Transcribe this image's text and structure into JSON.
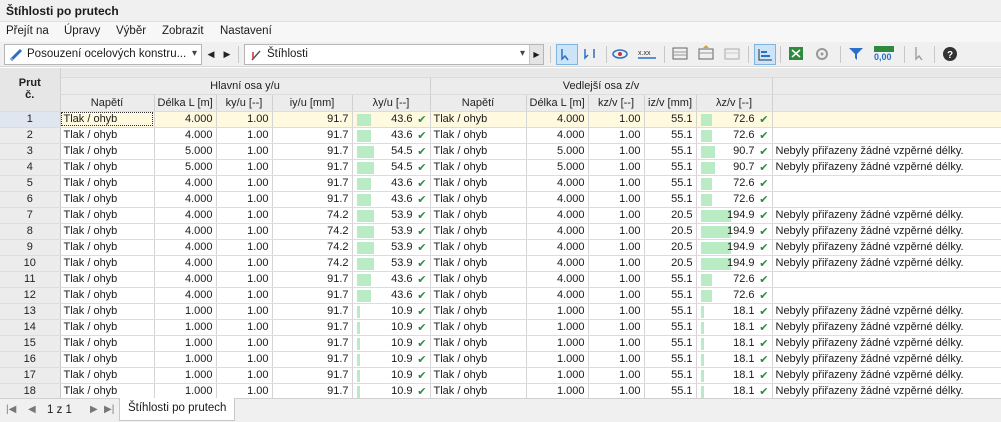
{
  "window": {
    "title": "Štíhlosti po prutech"
  },
  "menu": [
    "Přejít na",
    "Úpravy",
    "Výběr",
    "Zobrazit",
    "Nastavení"
  ],
  "toolbar": {
    "combo1": "Posouzení ocelových konstru...",
    "combo2": "Štíhlosti",
    "zoom_value": "0,00"
  },
  "table": {
    "headers": {
      "prut": "Prut",
      "prut_sub": "č.",
      "group_y": "Hlavní osa y/u",
      "group_z": "Vedlejší osa z/v",
      "napeti": "Napětí",
      "delka": "Délka L [m]",
      "k_y": "ky/u [--]",
      "i_y": "iy/u [mm]",
      "lambda_y": "λy/u [--]",
      "napeti_z": "Napětí",
      "delka_z": "Délka L [m]",
      "k_z": "kz/v [--]",
      "i_z": "iz/v [mm]",
      "lambda_z": "λz/v [--]"
    },
    "lambda_max": 194.9,
    "rows": [
      {
        "n": "1",
        "s": "Tlak / ohyb",
        "L": "4.000",
        "k": "1.00",
        "i": "91.7",
        "lam": "43.6",
        "sz": "Tlak / ohyb",
        "Lz": "4.000",
        "kz": "1.00",
        "iz": "55.1",
        "lamz": "72.6",
        "note": ""
      },
      {
        "n": "2",
        "s": "Tlak / ohyb",
        "L": "4.000",
        "k": "1.00",
        "i": "91.7",
        "lam": "43.6",
        "sz": "Tlak / ohyb",
        "Lz": "4.000",
        "kz": "1.00",
        "iz": "55.1",
        "lamz": "72.6",
        "note": ""
      },
      {
        "n": "3",
        "s": "Tlak / ohyb",
        "L": "5.000",
        "k": "1.00",
        "i": "91.7",
        "lam": "54.5",
        "sz": "Tlak / ohyb",
        "Lz": "5.000",
        "kz": "1.00",
        "iz": "55.1",
        "lamz": "90.7",
        "note": "Nebyly přiřazeny žádné vzpěrné délky."
      },
      {
        "n": "4",
        "s": "Tlak / ohyb",
        "L": "5.000",
        "k": "1.00",
        "i": "91.7",
        "lam": "54.5",
        "sz": "Tlak / ohyb",
        "Lz": "5.000",
        "kz": "1.00",
        "iz": "55.1",
        "lamz": "90.7",
        "note": "Nebyly přiřazeny žádné vzpěrné délky."
      },
      {
        "n": "5",
        "s": "Tlak / ohyb",
        "L": "4.000",
        "k": "1.00",
        "i": "91.7",
        "lam": "43.6",
        "sz": "Tlak / ohyb",
        "Lz": "4.000",
        "kz": "1.00",
        "iz": "55.1",
        "lamz": "72.6",
        "note": ""
      },
      {
        "n": "6",
        "s": "Tlak / ohyb",
        "L": "4.000",
        "k": "1.00",
        "i": "91.7",
        "lam": "43.6",
        "sz": "Tlak / ohyb",
        "Lz": "4.000",
        "kz": "1.00",
        "iz": "55.1",
        "lamz": "72.6",
        "note": ""
      },
      {
        "n": "7",
        "s": "Tlak / ohyb",
        "L": "4.000",
        "k": "1.00",
        "i": "74.2",
        "lam": "53.9",
        "sz": "Tlak / ohyb",
        "Lz": "4.000",
        "kz": "1.00",
        "iz": "20.5",
        "lamz": "194.9",
        "note": "Nebyly přiřazeny žádné vzpěrné délky."
      },
      {
        "n": "8",
        "s": "Tlak / ohyb",
        "L": "4.000",
        "k": "1.00",
        "i": "74.2",
        "lam": "53.9",
        "sz": "Tlak / ohyb",
        "Lz": "4.000",
        "kz": "1.00",
        "iz": "20.5",
        "lamz": "194.9",
        "note": "Nebyly přiřazeny žádné vzpěrné délky."
      },
      {
        "n": "9",
        "s": "Tlak / ohyb",
        "L": "4.000",
        "k": "1.00",
        "i": "74.2",
        "lam": "53.9",
        "sz": "Tlak / ohyb",
        "Lz": "4.000",
        "kz": "1.00",
        "iz": "20.5",
        "lamz": "194.9",
        "note": "Nebyly přiřazeny žádné vzpěrné délky."
      },
      {
        "n": "10",
        "s": "Tlak / ohyb",
        "L": "4.000",
        "k": "1.00",
        "i": "74.2",
        "lam": "53.9",
        "sz": "Tlak / ohyb",
        "Lz": "4.000",
        "kz": "1.00",
        "iz": "20.5",
        "lamz": "194.9",
        "note": "Nebyly přiřazeny žádné vzpěrné délky."
      },
      {
        "n": "11",
        "s": "Tlak / ohyb",
        "L": "4.000",
        "k": "1.00",
        "i": "91.7",
        "lam": "43.6",
        "sz": "Tlak / ohyb",
        "Lz": "4.000",
        "kz": "1.00",
        "iz": "55.1",
        "lamz": "72.6",
        "note": ""
      },
      {
        "n": "12",
        "s": "Tlak / ohyb",
        "L": "4.000",
        "k": "1.00",
        "i": "91.7",
        "lam": "43.6",
        "sz": "Tlak / ohyb",
        "Lz": "4.000",
        "kz": "1.00",
        "iz": "55.1",
        "lamz": "72.6",
        "note": ""
      },
      {
        "n": "13",
        "s": "Tlak / ohyb",
        "L": "1.000",
        "k": "1.00",
        "i": "91.7",
        "lam": "10.9",
        "sz": "Tlak / ohyb",
        "Lz": "1.000",
        "kz": "1.00",
        "iz": "55.1",
        "lamz": "18.1",
        "note": "Nebyly přiřazeny žádné vzpěrné délky."
      },
      {
        "n": "14",
        "s": "Tlak / ohyb",
        "L": "1.000",
        "k": "1.00",
        "i": "91.7",
        "lam": "10.9",
        "sz": "Tlak / ohyb",
        "Lz": "1.000",
        "kz": "1.00",
        "iz": "55.1",
        "lamz": "18.1",
        "note": "Nebyly přiřazeny žádné vzpěrné délky."
      },
      {
        "n": "15",
        "s": "Tlak / ohyb",
        "L": "1.000",
        "k": "1.00",
        "i": "91.7",
        "lam": "10.9",
        "sz": "Tlak / ohyb",
        "Lz": "1.000",
        "kz": "1.00",
        "iz": "55.1",
        "lamz": "18.1",
        "note": "Nebyly přiřazeny žádné vzpěrné délky."
      },
      {
        "n": "16",
        "s": "Tlak / ohyb",
        "L": "1.000",
        "k": "1.00",
        "i": "91.7",
        "lam": "10.9",
        "sz": "Tlak / ohyb",
        "Lz": "1.000",
        "kz": "1.00",
        "iz": "55.1",
        "lamz": "18.1",
        "note": "Nebyly přiřazeny žádné vzpěrné délky."
      },
      {
        "n": "17",
        "s": "Tlak / ohyb",
        "L": "1.000",
        "k": "1.00",
        "i": "91.7",
        "lam": "10.9",
        "sz": "Tlak / ohyb",
        "Lz": "1.000",
        "kz": "1.00",
        "iz": "55.1",
        "lamz": "18.1",
        "note": "Nebyly přiřazeny žádné vzpěrné délky."
      },
      {
        "n": "18",
        "s": "Tlak / ohyb",
        "L": "1.000",
        "k": "1.00",
        "i": "91.7",
        "lam": "10.9",
        "sz": "Tlak / ohyb",
        "Lz": "1.000",
        "kz": "1.00",
        "iz": "55.1",
        "lamz": "18.1",
        "note": "Nebyly přiřazeny žádné vzpěrné délky."
      }
    ]
  },
  "status": {
    "page": "1 z 1",
    "sheet_tab": "Štíhlosti po prutech"
  },
  "colors": {
    "bar": "#b9ebc4",
    "check": "#2e8b3e",
    "selected_row": "#fff9e0",
    "active_button": "#cce4f7"
  }
}
